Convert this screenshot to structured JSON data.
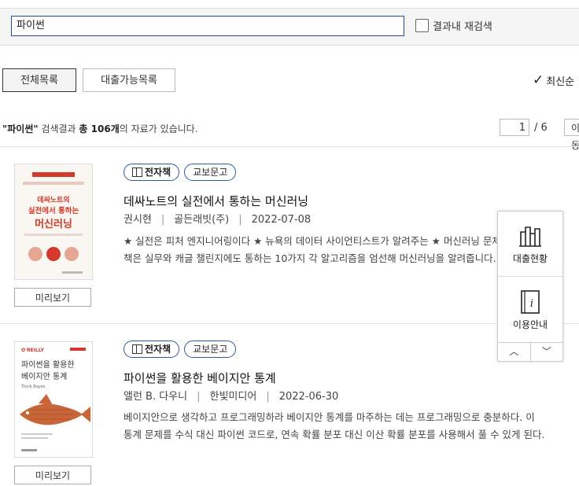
{
  "search": {
    "query": "파이썬",
    "research_label": "결과내 재검색"
  },
  "tabs": [
    {
      "label": "전체목록",
      "selected": true
    },
    {
      "label": "대출가능목록",
      "selected": false
    }
  ],
  "sort": {
    "label": "최신순"
  },
  "summary": {
    "query_quoted": "\"파이썬\"",
    "text_mid": " 검색결과 ",
    "total": "총 106개",
    "text_end": "의 자료가 있습니다."
  },
  "pager": {
    "current": "1",
    "total": "/ 6",
    "go_label": "이동"
  },
  "books": [
    {
      "badge_type": "전자책",
      "badge_vendor": "교보문고",
      "title": "데싸노트의 실전에서 통하는 머신러닝",
      "author": "권시현",
      "publisher": "골든래빗(주)",
      "date": "2022-07-08",
      "desc1": "★ 실전은 피처 엔지니어링이다 ★ 뉴욕의 데이터 사이언티스트가 알려주는 ★ 머신러닝 문제 해법",
      "desc2": "책은 실무와 캐글 챌린지에도 통하는 10가지 각 알고리즘을 엄선해 머신러닝을 알려줍니다. 아 대",
      "preview": "미리보기",
      "cover_line1": "데싸노트의",
      "cover_line2": "실전에서 통하는",
      "cover_line3": "머신러닝"
    },
    {
      "badge_type": "전자책",
      "badge_vendor": "교보문고",
      "title": "파이썬을 활용한 베이지안 통계",
      "author": "앨런 B. 다우니",
      "publisher": "한빛미디어",
      "date": "2022-06-30",
      "desc1": "베이지안으로 생각하고 프로그래밍하라 베이지안 통계를 마주하는 데는 프로그래밍으로 충분하다. 이",
      "desc2": "통계 문제를 수식 대신 파이썬 코드로, 연속 확률 분포 대신 이산 확률 분포를 사용해서 풀 수 있게 된다.",
      "preview": "미리보기",
      "cover_publisher": "O'REILLY",
      "cover_line1": "파이썬을 활용한",
      "cover_line2": "베이지안 통계",
      "cover_author": "Think Bayes"
    }
  ],
  "float_panel": {
    "loan_status": "대출현황",
    "guide": "이용안내",
    "up": "︿",
    "down": "﹀"
  },
  "colors": {
    "accent": "#2b5aa0",
    "cover_red": "#d23a2c",
    "cover_fish": "#c8663a"
  }
}
